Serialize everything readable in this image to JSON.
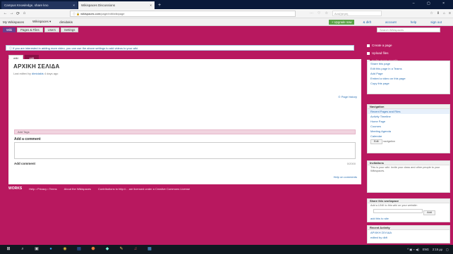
{
  "browser": {
    "tabs": [
      {
        "label": "Campus Knowledge, share kno",
        "close": "×"
      },
      {
        "label": "Wikispaces Discussions",
        "close": "×"
      }
    ],
    "new_tab": "+",
    "window_controls": "– ▢ ×",
    "url_prefix": "ⓘ 🔒 ",
    "url_domain": "wikispaces.com",
    "url_rest": "/page/edit/wikipage",
    "search_placeholder": "Αναζήτηση",
    "nav_icons": [
      "☆",
      "⬇",
      "⌂",
      "≡"
    ]
  },
  "appbar": {
    "items": [
      "My Wikispaces",
      "Wikispaces ▾",
      "dimidakis"
    ],
    "upgrade": "+ Upgrade now",
    "right_links": [
      "& dkft",
      "account",
      "help",
      "sign out"
    ]
  },
  "subbar": {
    "tabs": [
      "Wiki",
      "Pages & Files",
      "Users",
      "Settings"
    ],
    "search_placeholder": "Search Wikispaces"
  },
  "notice": "If you are interested in adding more video, you can use the above settings to add videos to your wiki.",
  "view_tabs": [
    "wiki",
    "edit"
  ],
  "page": {
    "title": "ΑΡΧΙΚΗ ΣΕΛΙΔΑ",
    "meta_prefix": "Last edited by ",
    "meta_author": "dimidakis",
    "meta_suffix": " 4 days ago",
    "history": "⊙ Page history",
    "tags_label": "Add Tags",
    "add_comment_heading": "Add a comment",
    "add_comment_button": "Add comment",
    "chars_left": "0/2000",
    "help_link": "Help on comments"
  },
  "footer": {
    "brand": "WORKS",
    "links": [
      "Help • Privacy • Terms",
      "About the Wikispaces",
      "Contributions to http://... are licensed under a Creative Commons License"
    ]
  },
  "sidebar": {
    "actions": [
      "Create a page",
      "Upload files",
      "Invite more people"
    ],
    "page_tools": [
      "Share this page",
      "Edit this page in a Teams",
      "Add Page",
      "Embed a video on this page",
      "Copy this page"
    ],
    "navigation": {
      "title": "Navigation",
      "items": [
        "Recent Pages and Files",
        "Activity Timeline",
        "Home Page",
        "Courses",
        "Meeting Agenda",
        "Calendar"
      ],
      "edit_button": "Edit",
      "edit_hint": "navigation"
    },
    "invite": {
      "title": "Invitations",
      "text": "This is your wiki. Invite your class and other people to your Wikispaces."
    },
    "share": {
      "title": "Share this workspace",
      "text": "Add a LINK to this wiki on your website:",
      "button": "Add",
      "link": "add this to site"
    },
    "recent": {
      "title": "Recent Activity",
      "items": [
        "ΑΡΧΙΚΗ ΣΕΛΙΔΑ",
        "edited by dkft"
      ]
    }
  },
  "taskbar": {
    "icons": [
      "⊞",
      "⌕",
      "▣",
      "●",
      "◉",
      "▤",
      "⬣",
      "◆",
      "✎",
      "♫",
      "▦"
    ],
    "tray": [
      "^ ▣ ⌁ ◀)",
      "ENG",
      "2:15 μμ",
      "▢"
    ]
  }
}
